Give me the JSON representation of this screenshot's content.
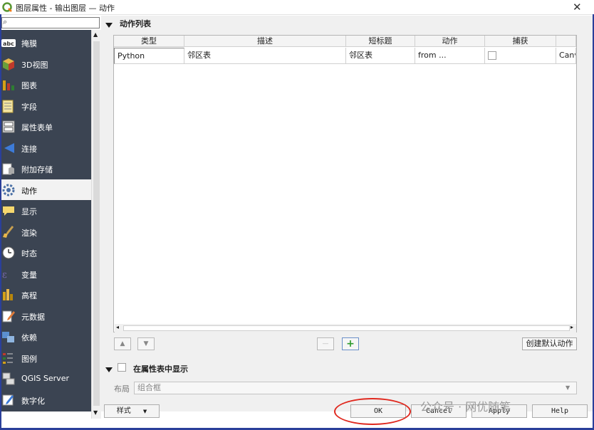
{
  "window": {
    "title": "图层属性 - 输出图层 — 动作",
    "close_glyph": "✕"
  },
  "search": {
    "placeholder": ""
  },
  "sidebar": {
    "items": [
      {
        "label": "掩膜",
        "icon": "abc-label-icon"
      },
      {
        "label": "3D视图",
        "icon": "cube-3d-icon"
      },
      {
        "label": "图表",
        "icon": "diagram-icon"
      },
      {
        "label": "字段",
        "icon": "fields-icon"
      },
      {
        "label": "属性表单",
        "icon": "attribute-form-icon"
      },
      {
        "label": "连接",
        "icon": "join-icon"
      },
      {
        "label": "附加存储",
        "icon": "auxiliary-storage-icon"
      },
      {
        "label": "动作",
        "icon": "action-gear-icon",
        "active": true
      },
      {
        "label": "显示",
        "icon": "display-tip-icon"
      },
      {
        "label": "渲染",
        "icon": "rendering-brush-icon"
      },
      {
        "label": "时态",
        "icon": "temporal-clock-icon"
      },
      {
        "label": "变量",
        "icon": "variables-icon"
      },
      {
        "label": "高程",
        "icon": "elevation-icon"
      },
      {
        "label": "元数据",
        "icon": "metadata-pencil-icon"
      },
      {
        "label": "依赖",
        "icon": "dependencies-icon"
      },
      {
        "label": "图例",
        "icon": "legend-icon"
      },
      {
        "label": "QGIS Server",
        "icon": "qgis-server-icon"
      },
      {
        "label": "数字化",
        "icon": "digitizing-icon"
      }
    ]
  },
  "actions_section": {
    "title": "动作列表"
  },
  "table": {
    "columns": [
      "类型",
      "描述",
      "短标题",
      "动作",
      "捕获",
      ""
    ],
    "rows": [
      {
        "type": "Python",
        "description": "邻区表",
        "short_title": "邻区表",
        "action": "from ...",
        "capture": false,
        "extra": "Canv"
      }
    ]
  },
  "buttons": {
    "move_up": "▲",
    "move_down": "▼",
    "remove": "—",
    "add": "+",
    "create_default": "创建默认动作",
    "style": "样式",
    "ok": "OK",
    "cancel": "Cancel",
    "apply": "Apply",
    "help": "Help"
  },
  "show_in_table": {
    "label": "在属性表中显示",
    "checked": false
  },
  "layout": {
    "label": "布局",
    "value": "组合框"
  },
  "watermark": "公众号 · 网优随笔",
  "colors": {
    "sidebar_bg": "#3b4452",
    "accent_border": "#2a3f9a",
    "highlight_oval": "#e0281e"
  }
}
